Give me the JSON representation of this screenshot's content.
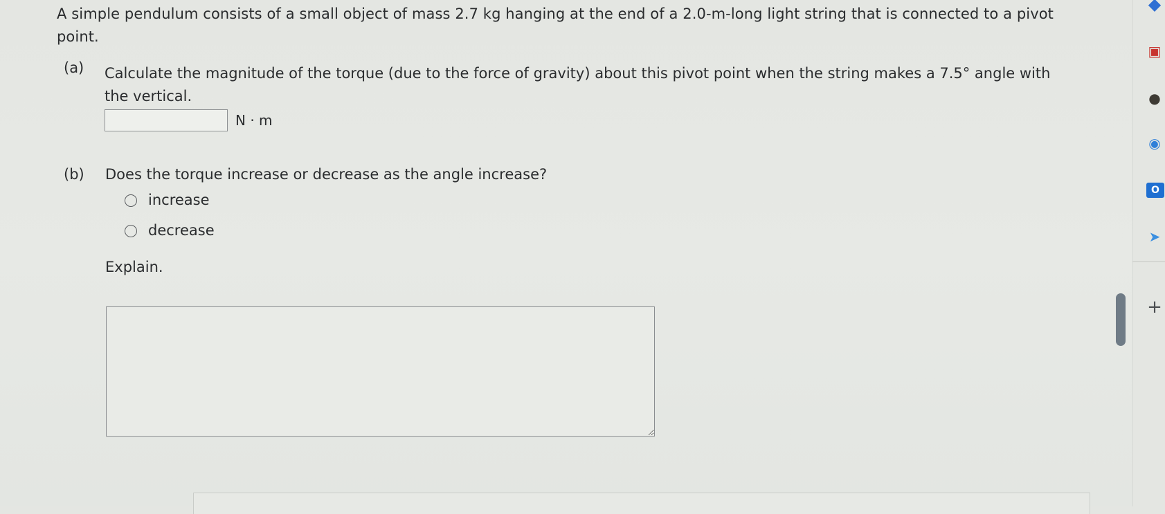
{
  "question": {
    "intro": "A simple pendulum consists of a small object of mass 2.7 kg hanging at the end of a 2.0-m-long light string that is connected to a pivot point.",
    "part_a": {
      "letter": "(a)",
      "text": "Calculate the magnitude of the torque (due to the force of gravity) about this pivot point when the string makes a 7.5° angle with the vertical.",
      "answer_value": "",
      "unit": "N · m"
    },
    "part_b": {
      "letter": "(b)",
      "text": "Does the torque increase or decrease as the angle increase?",
      "options": [
        "increase",
        "decrease"
      ],
      "explain_label": "Explain.",
      "explain_value": ""
    }
  },
  "sidebar": {
    "icons": [
      "bing-diamond-icon",
      "shopping-bag-icon",
      "user-icon",
      "copilot-icon",
      "outlook-icon",
      "send-icon",
      "add-icon"
    ],
    "plus_glyph": "+",
    "outlook_glyph": "O"
  },
  "colors": {
    "background": "#e6e8e4",
    "text": "#2a2c2e",
    "border": "#8f9294",
    "scroll_thumb": "#6f7b86"
  }
}
